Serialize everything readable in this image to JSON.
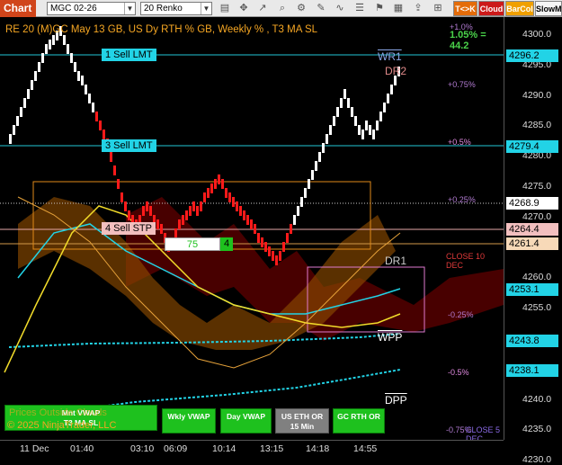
{
  "toolbar": {
    "title": "Chart",
    "instrument": "MGC 02-26",
    "bar_type": "20 Renko",
    "buttons": {
      "tick_counter": "T<>K",
      "cloud": "Cloud",
      "barcol": "BarCol",
      "slowm": "SlowM"
    }
  },
  "chart": {
    "title": "RE 20  (M)GC May 13 GB, US Dy RTH % GB, Weekly % , T3 MA SL",
    "copyright": "© 2025 NinjaTrader, LLC",
    "watermark": "Prices Outside Clouds",
    "colors": {
      "up": "#ffffff",
      "down": "#ff1a1a",
      "accent": "#f5a623",
      "cyan": "#22d3e6"
    }
  },
  "orders": [
    {
      "label": "1 Sell LMT",
      "price": "4296.2"
    },
    {
      "label": "3 Sell LMT",
      "price": "4279.4"
    },
    {
      "label": "4 Sell STP",
      "price": "4264.4"
    }
  ],
  "position": {
    "qty": "75",
    "count": "4"
  },
  "price_axis": {
    "ticks": [
      "4300.0",
      "4295.0",
      "4290.0",
      "4285.0",
      "4280.0",
      "4275.0",
      "4270.0",
      "4265.0",
      "4260.0",
      "4255.0",
      "4250.0",
      "4245.0",
      "4240.0",
      "4235.0",
      "4230.0"
    ],
    "tags": {
      "order1": "4296.2",
      "order3": "4279.4",
      "last": "4268.9",
      "order4": "4264.4",
      "ma": "4261.4",
      "cyan1": "4253.1",
      "cyan2": "4243.8",
      "cyan3": "4238.1"
    }
  },
  "time_axis": {
    "labels": [
      "11 Dec",
      "01:40",
      "03:10",
      "06:09",
      "10:14",
      "13:15",
      "14:18",
      "14:55"
    ]
  },
  "levels": {
    "pct_1": "+1.0%",
    "pct_label": "1.05% = 44.2",
    "wr1": "WR1",
    "dr2": "DR2",
    "p075": "+0.75%",
    "p05": "+0.5%",
    "p025": "+0.25%",
    "dr1": "DR1",
    "close": "CLOSE 10 DEC",
    "m025": "-0.25%",
    "wpp": "WPP",
    "m05": "-0.5%",
    "dpp": "DPP",
    "m075": "-0.75%",
    "close5": "CLOSE 5 DEC"
  },
  "vwap_buttons": [
    "Mnt VWAP",
    "T3 MA SL",
    "Wkly VWAP",
    "Day VWAP",
    "US ETH OR 15 Min",
    "GC RTH OR"
  ]
}
